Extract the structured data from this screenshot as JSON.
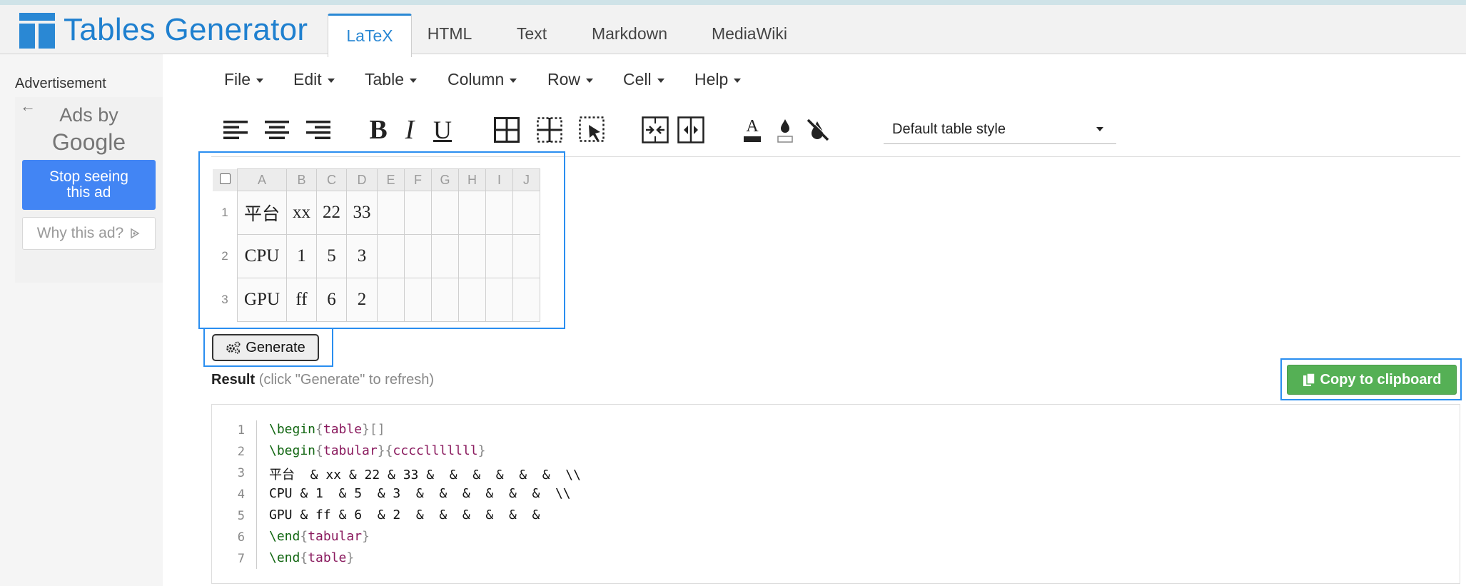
{
  "header": {
    "brand": "Tables Generator",
    "tabs": [
      {
        "label": "LaTeX",
        "active": true
      },
      {
        "label": "HTML"
      },
      {
        "label": "Text"
      },
      {
        "label": "Markdown"
      },
      {
        "label": "MediaWiki"
      }
    ]
  },
  "ad": {
    "label": "Advertisement",
    "ads_by": "Ads by",
    "google": "Google",
    "stop_line1": "Stop seeing",
    "stop_line2": "this ad",
    "why": "Why this ad?"
  },
  "menu": [
    "File",
    "Edit",
    "Table",
    "Column",
    "Row",
    "Cell",
    "Help"
  ],
  "toolbar": {
    "bold": "B",
    "italic": "I",
    "underline": "U",
    "text_color_letter": "A",
    "table_style": "Default table style"
  },
  "grid": {
    "columns": [
      "A",
      "B",
      "C",
      "D",
      "E",
      "F",
      "G",
      "H",
      "I",
      "J"
    ],
    "rows": [
      {
        "num": "1",
        "cells": [
          "平台",
          "xx",
          "22",
          "33",
          "",
          "",
          "",
          "",
          "",
          ""
        ]
      },
      {
        "num": "2",
        "cells": [
          "CPU",
          "1",
          "5",
          "3",
          "",
          "",
          "",
          "",
          "",
          ""
        ]
      },
      {
        "num": "3",
        "cells": [
          "GPU",
          "ff",
          "6",
          "2",
          "",
          "",
          "",
          "",
          "",
          ""
        ]
      }
    ]
  },
  "generate_label": "Generate",
  "result": {
    "title": "Result",
    "hint": "(click \"Generate\" to refresh)"
  },
  "copy_label": "Copy to clipboard",
  "code": {
    "line_numbers": [
      "1",
      "2",
      "3",
      "4",
      "5",
      "6",
      "7"
    ],
    "lines": [
      [
        {
          "t": "\\begin",
          "c": "kw"
        },
        {
          "t": "{",
          "c": "br"
        },
        {
          "t": "table",
          "c": "arg"
        },
        {
          "t": "}[]",
          "c": "br"
        }
      ],
      [
        {
          "t": "\\begin",
          "c": "kw"
        },
        {
          "t": "{",
          "c": "br"
        },
        {
          "t": "tabular",
          "c": "arg"
        },
        {
          "t": "}{",
          "c": "br"
        },
        {
          "t": "cccclllllll",
          "c": "arg"
        },
        {
          "t": "}",
          "c": "br"
        }
      ],
      [
        {
          "t": "平台  & xx & 22 & 33 &  &  &  &  &  &  \\\\",
          "c": "tx"
        }
      ],
      [
        {
          "t": "CPU & 1  & 5  & 3  &  &  &  &  &  &  \\\\",
          "c": "tx"
        }
      ],
      [
        {
          "t": "GPU & ff & 6  & 2  &  &  &  &  &  &",
          "c": "tx"
        }
      ],
      [
        {
          "t": "\\end",
          "c": "kw"
        },
        {
          "t": "{",
          "c": "br"
        },
        {
          "t": "tabular",
          "c": "arg"
        },
        {
          "t": "}",
          "c": "br"
        }
      ],
      [
        {
          "t": "\\end",
          "c": "kw"
        },
        {
          "t": "{",
          "c": "br"
        },
        {
          "t": "table",
          "c": "arg"
        },
        {
          "t": "}",
          "c": "br"
        }
      ]
    ]
  }
}
